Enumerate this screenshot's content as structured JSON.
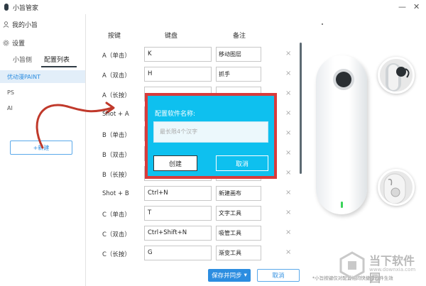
{
  "titlebar": {
    "title": "小旨管家",
    "minimize": "—",
    "close": "✕"
  },
  "sidebar": {
    "items": [
      {
        "label": "我的小旨",
        "icon": "user-icon"
      },
      {
        "label": "设置",
        "icon": "gear-icon"
      }
    ],
    "tabs": [
      {
        "label": "小旨侧",
        "active": false
      },
      {
        "label": "配置列表",
        "active": true
      }
    ],
    "profiles": [
      {
        "label": "优动漫PAINT",
        "active": true
      },
      {
        "label": "PS",
        "active": false
      },
      {
        "label": "AI",
        "active": false
      }
    ],
    "new_button": "+新建"
  },
  "table": {
    "headers": {
      "key": "按键",
      "keyboard": "键盘",
      "note": "备注"
    },
    "rows": [
      {
        "label": "A（单击）",
        "keyboard": "K",
        "note": "移动图层"
      },
      {
        "label": "A（双击）",
        "keyboard": "H",
        "note": "抓手"
      },
      {
        "label": "A（长按）",
        "keyboard": "",
        "note": ""
      },
      {
        "label": "Shot + A",
        "keyboard": "",
        "note": ""
      },
      {
        "label": "B（单击）",
        "keyboard": "",
        "note": ""
      },
      {
        "label": "B（双击）",
        "keyboard": "",
        "note": ""
      },
      {
        "label": "B（长按）",
        "keyboard": "",
        "note": ""
      },
      {
        "label": "Shot + B",
        "keyboard": "Ctrl+N",
        "note": "新建画布"
      },
      {
        "label": "C（单击）",
        "keyboard": "T",
        "note": "文字工具"
      },
      {
        "label": "C（双击）",
        "keyboard": "Ctrl+Shift+N",
        "note": "吸管工具"
      },
      {
        "label": "C（长按）",
        "keyboard": "G",
        "note": "渐变工具"
      }
    ],
    "delete_glyph": "×"
  },
  "dialog": {
    "title": "配置软件名称:",
    "input_placeholder": "最长限4个汉字",
    "create_label": "创建",
    "cancel_label": "取消"
  },
  "footer": {
    "save_label": "保存并同步",
    "save_caret": "▾",
    "cancel_label": "取消",
    "note": "*小旨按键仅对配置相同快捷键软件生效"
  },
  "watermark": {
    "name": "当下软件园",
    "url": "www.downxia.com"
  },
  "colors": {
    "accent": "#2c8de0",
    "dialog_bg": "#0ec0ef",
    "highlight_border": "#d93b3b",
    "arrow": "#c0392b",
    "led": "#3bd35a"
  }
}
